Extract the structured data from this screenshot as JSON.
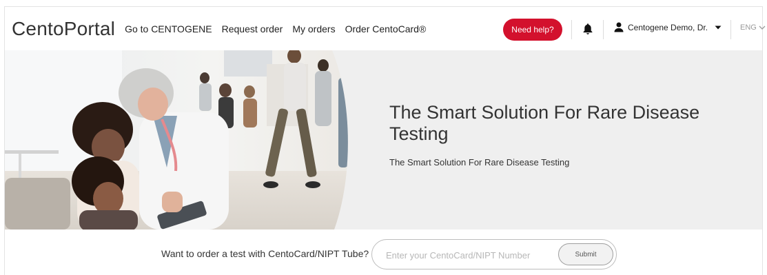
{
  "header": {
    "logo": "CentoPortal",
    "nav": [
      {
        "id": "go-centogene",
        "label": "Go to CENTOGENE"
      },
      {
        "id": "request-order",
        "label": "Request order"
      },
      {
        "id": "my-orders",
        "label": "My orders"
      },
      {
        "id": "order-centocard",
        "label": "Order CentoCard®"
      }
    ],
    "help_label": "Need help?",
    "user_name": "Centogene Demo, Dr.",
    "language": "ENG",
    "icons": {
      "bell": "bell-icon",
      "user": "user-icon",
      "caret": "caret-down-icon",
      "chevron": "chevron-down-icon"
    }
  },
  "hero": {
    "title": "The Smart Solution For Rare Disease Testing",
    "subtitle": "The Smart Solution For Rare Disease Testing"
  },
  "order_bar": {
    "label": "Want to order a test with CentoCard/NIPT Tube?",
    "input_value": "",
    "placeholder": "Enter your CentoCard/NIPT Number",
    "submit_label": "Submit"
  },
  "colors": {
    "accent": "#d3112d",
    "hero_bg": "#efefef"
  }
}
